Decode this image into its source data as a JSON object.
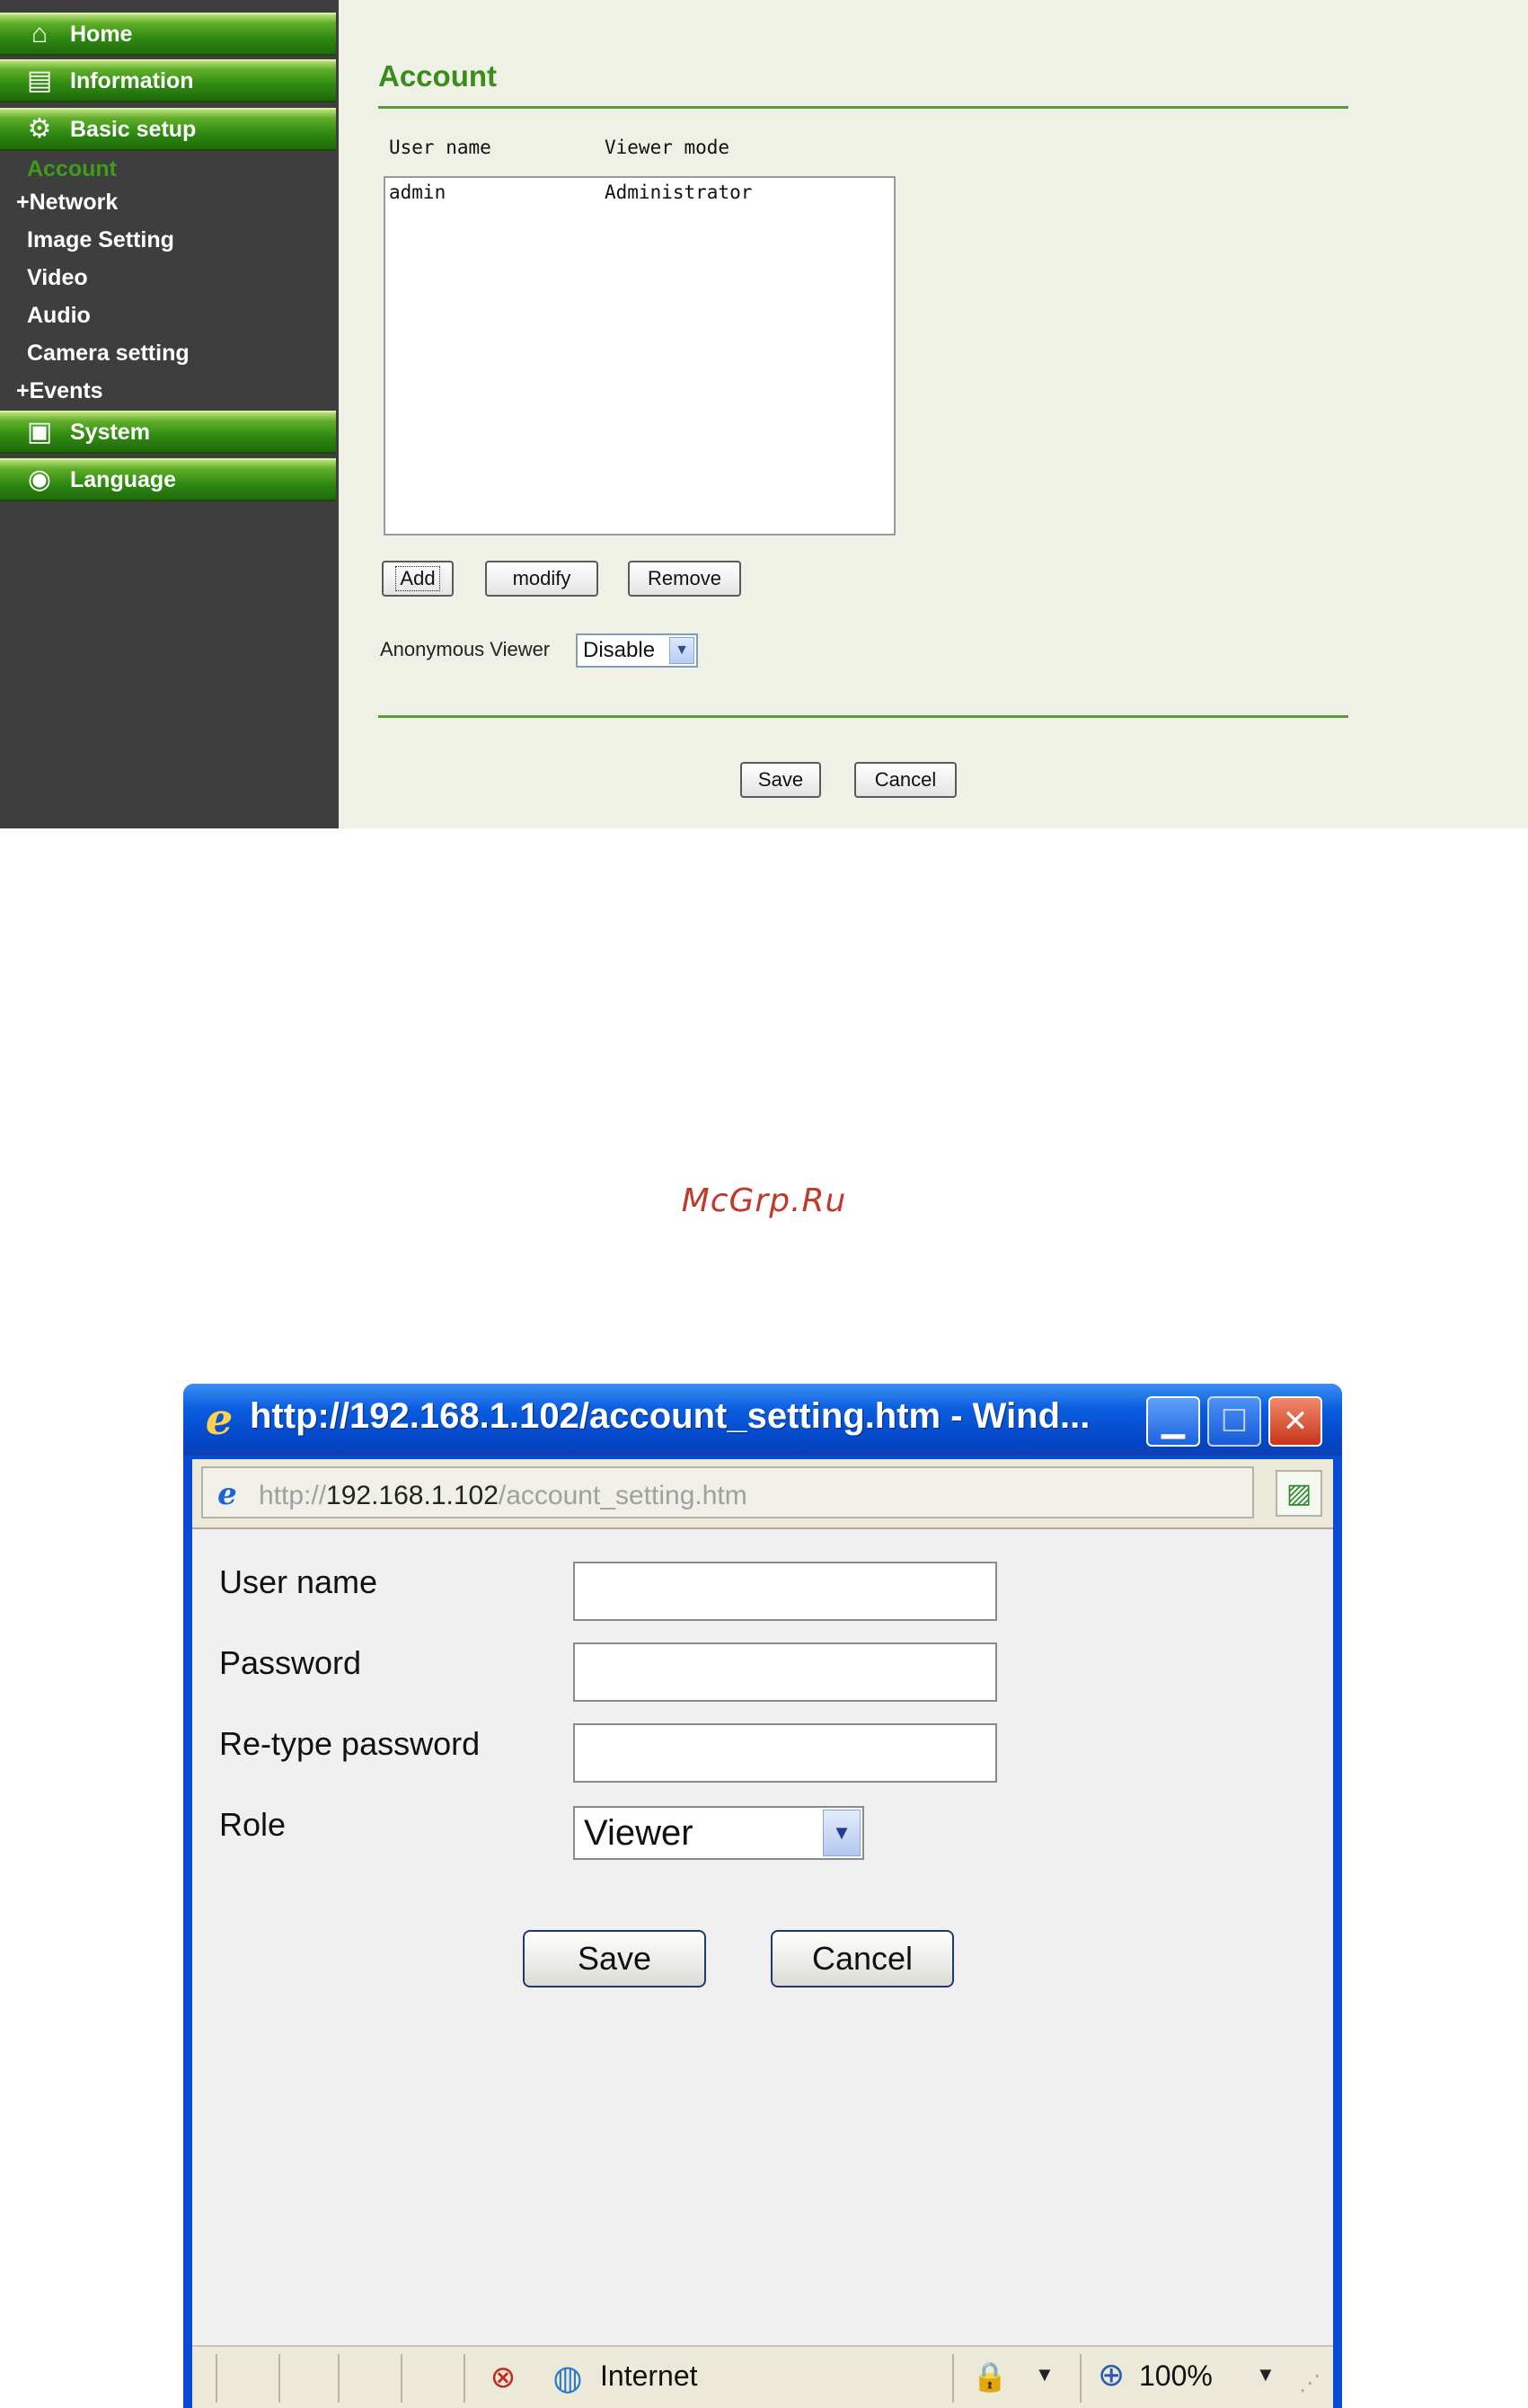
{
  "sidebar": {
    "main_items": [
      {
        "label": "Home",
        "icon": "home-icon"
      },
      {
        "label": "Information",
        "icon": "document-icon"
      },
      {
        "label": "Basic setup",
        "icon": "gear-icon"
      },
      {
        "label": "System",
        "icon": "system-icon"
      },
      {
        "label": "Language",
        "icon": "globe-icon"
      }
    ],
    "sub_items": [
      {
        "label": "Account",
        "active": true
      },
      {
        "label": "+Network"
      },
      {
        "label": "Image Setting"
      },
      {
        "label": "Video"
      },
      {
        "label": "Audio"
      },
      {
        "label": "Camera setting"
      },
      {
        "label": "+Events"
      }
    ]
  },
  "account_page": {
    "title": "Account",
    "col_user_name": "User name",
    "col_viewer_mode": "Viewer mode",
    "users": [
      {
        "name": "admin",
        "mode": "Administrator"
      }
    ],
    "add_label": "Add",
    "modify_label": "modify",
    "remove_label": "Remove",
    "anonymous_label": "Anonymous Viewer",
    "anonymous_value": "Disable",
    "save_label": "Save",
    "cancel_label": "Cancel"
  },
  "watermark": "McGrp.Ru",
  "popup": {
    "window_title": "http://192.168.1.102/account_setting.htm - Wind...",
    "address_prefix": "http://",
    "address_host": "192.168.1.102",
    "address_path": "/account_setting.htm",
    "user_name_label": "User name",
    "password_label": "Password",
    "retype_label": "Re-type password",
    "role_label": "Role",
    "role_value": "Viewer",
    "save_label": "Save",
    "cancel_label": "Cancel",
    "status_zone": "Internet",
    "status_zoom": "100%"
  },
  "colors": {
    "accent_green": "#3a8d1c",
    "sidebar_bg": "#3e3e3e",
    "content_bg": "#eff1e6",
    "xp_blue": "#0a4bd6"
  }
}
